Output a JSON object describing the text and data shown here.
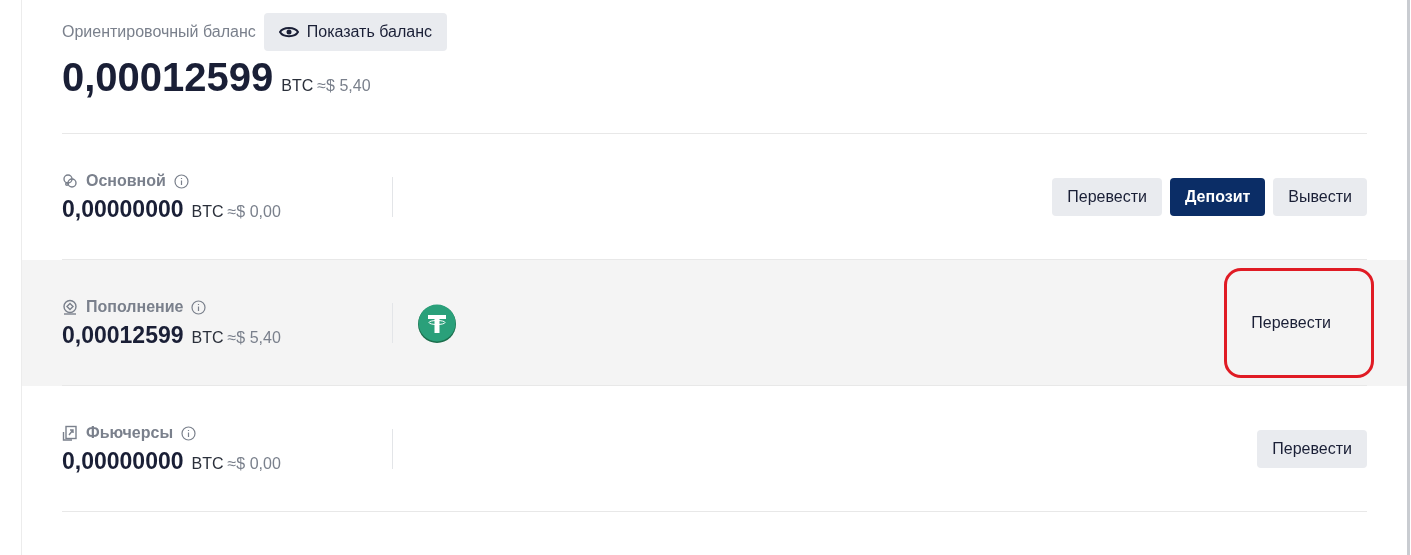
{
  "summary": {
    "label": "Ориентировочный баланс",
    "show_button": "Показать баланс",
    "amount": "0,00012599",
    "unit": "BTC",
    "approx": "≈$ 5,40"
  },
  "accounts": [
    {
      "name": "Основной",
      "amount": "0,00000000",
      "unit": "BTC",
      "approx": "≈$ 0,00",
      "highlighted": false,
      "buttons": [
        {
          "label": "Перевести",
          "kind": "secondary",
          "circled": false
        },
        {
          "label": "Депозит",
          "kind": "primary",
          "circled": false
        },
        {
          "label": "Вывести",
          "kind": "secondary",
          "circled": false
        }
      ]
    },
    {
      "name": "Пополнение",
      "amount": "0,00012599",
      "unit": "BTC",
      "approx": "≈$ 5,40",
      "highlighted": true,
      "coins": [
        {
          "kind": "tether"
        }
      ],
      "buttons": [
        {
          "label": "Перевести",
          "kind": "plain",
          "circled": true
        }
      ]
    },
    {
      "name": "Фьючерсы",
      "amount": "0,00000000",
      "unit": "BTC",
      "approx": "≈$ 0,00",
      "highlighted": false,
      "buttons": [
        {
          "label": "Перевести",
          "kind": "secondary",
          "circled": false
        }
      ]
    }
  ]
}
